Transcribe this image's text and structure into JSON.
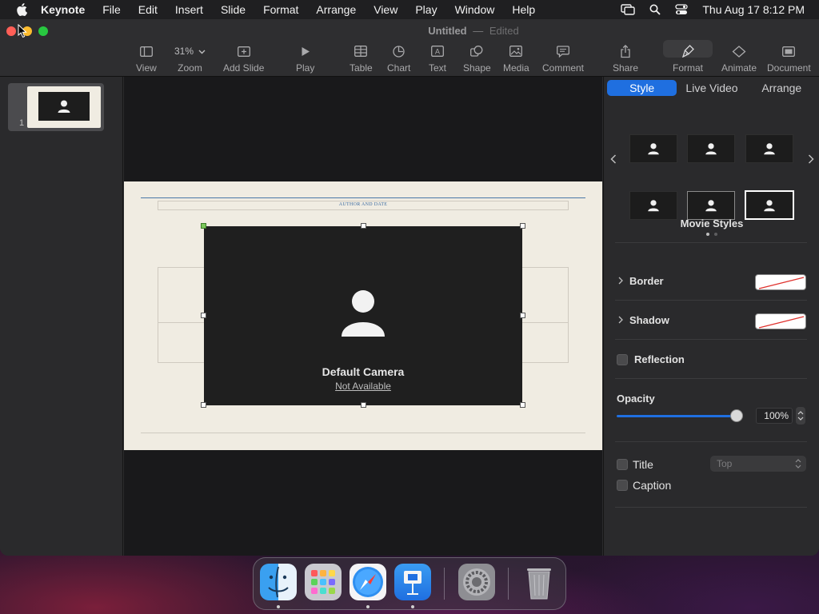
{
  "menubar": {
    "app_name": "Keynote",
    "items": [
      "File",
      "Edit",
      "Insert",
      "Slide",
      "Format",
      "Arrange",
      "View",
      "Play",
      "Window",
      "Help"
    ],
    "clock": "Thu Aug 17  8:12 PM"
  },
  "window": {
    "doc_name": "Untitled",
    "separator": "—",
    "doc_state": "Edited"
  },
  "toolbar": {
    "view": "View",
    "zoom_value": "31%",
    "zoom": "Zoom",
    "add_slide": "Add Slide",
    "play": "Play",
    "table": "Table",
    "chart": "Chart",
    "text": "Text",
    "shape": "Shape",
    "media": "Media",
    "comment": "Comment",
    "share": "Share",
    "format": "Format",
    "animate": "Animate",
    "document": "Document"
  },
  "navigator": {
    "slide_number": "1"
  },
  "slide": {
    "author_text": "AUTHOR AND DATE",
    "camera_title": "Default Camera",
    "camera_status": "Not Available"
  },
  "inspector": {
    "tabs": [
      "Style",
      "Live Video",
      "Arrange"
    ],
    "active_tab": "Style",
    "movie_styles": "Movie Styles",
    "border": "Border",
    "shadow": "Shadow",
    "reflection": "Reflection",
    "opacity_label": "Opacity",
    "opacity_value": "100%",
    "title": "Title",
    "title_position": "Top",
    "caption": "Caption"
  },
  "colors": {
    "accent": "#1f6fe0",
    "slide_bg": "#f0ece2",
    "camera_bg": "#1f1f1f"
  }
}
